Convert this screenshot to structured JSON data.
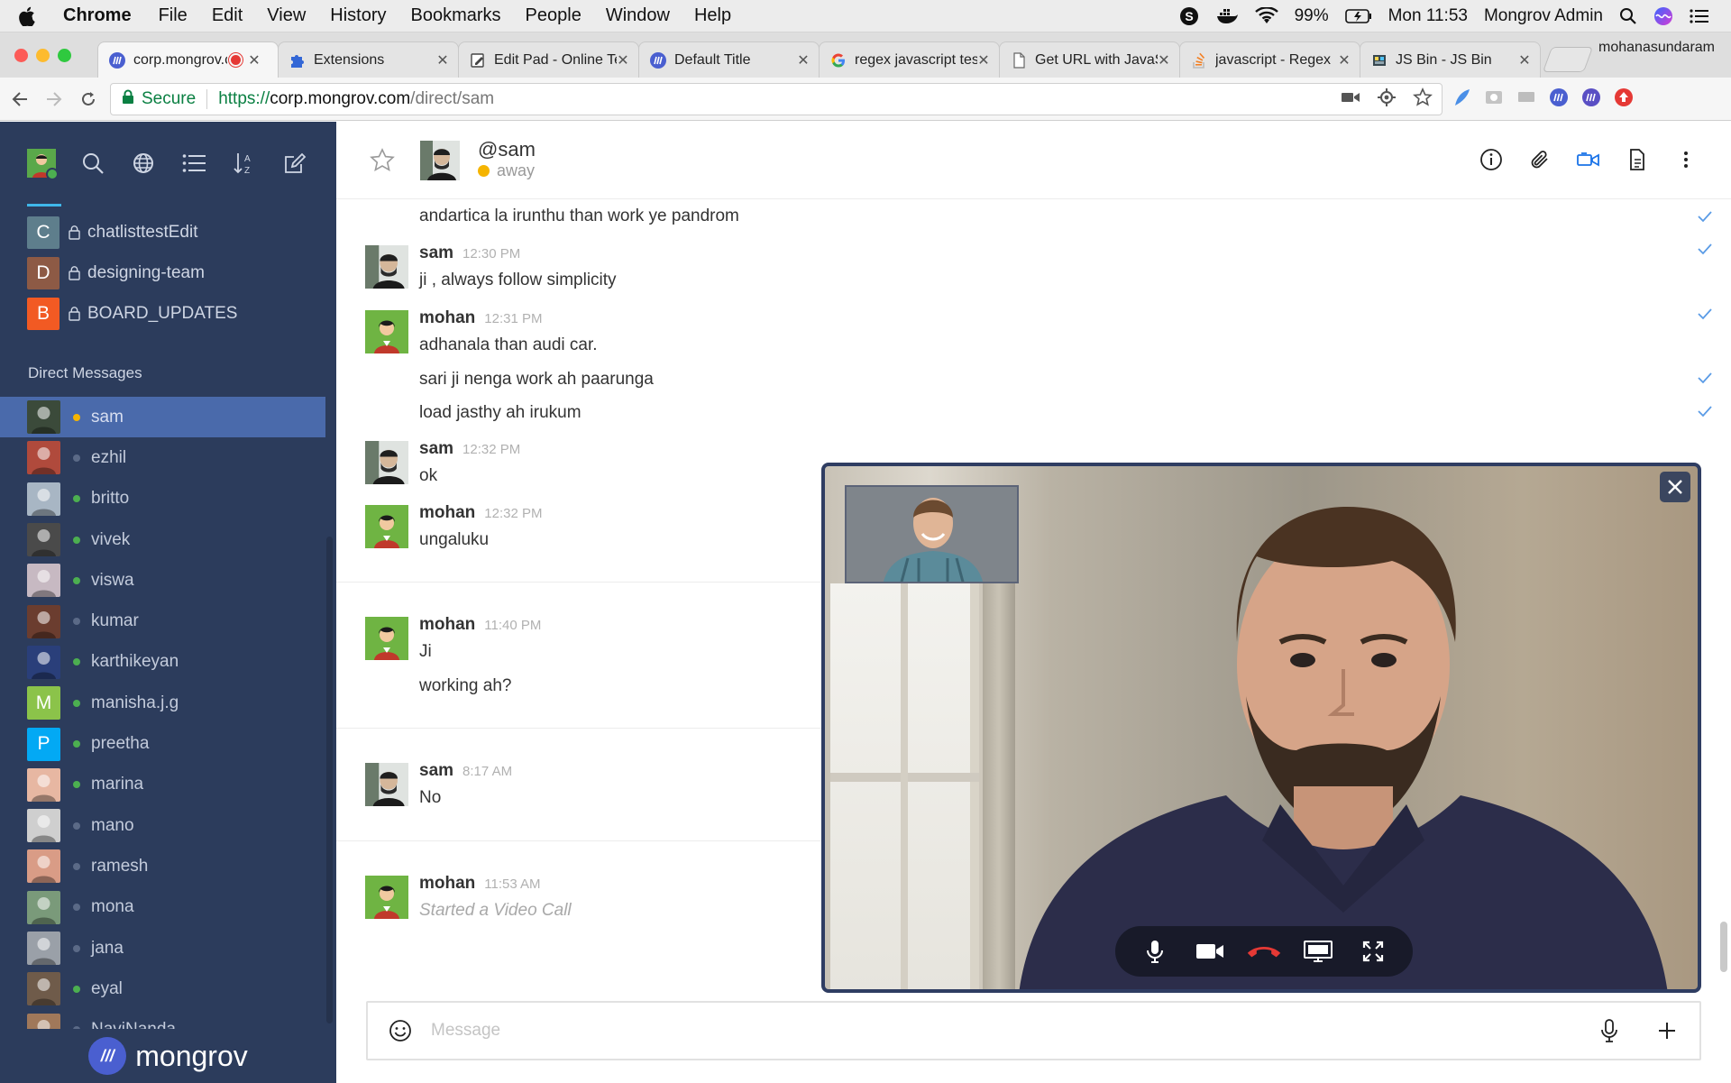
{
  "os_menu": {
    "app_name": "Chrome",
    "items": [
      "File",
      "Edit",
      "View",
      "History",
      "Bookmarks",
      "People",
      "Window",
      "Help"
    ],
    "battery": "99%",
    "clock": "Mon 11:53",
    "user": "Mongrov Admin"
  },
  "browser": {
    "tabs": [
      {
        "title": "corp.mongrov.com",
        "favicon": "mongrov-logo-icon",
        "recording": true,
        "active": true
      },
      {
        "title": "Extensions",
        "favicon": "puzzle-icon"
      },
      {
        "title": "Edit Pad - Online Text Editor",
        "favicon": "editpad-icon"
      },
      {
        "title": "Default Title",
        "favicon": "mongrov-logo-icon"
      },
      {
        "title": "regex javascript tester",
        "favicon": "google-icon"
      },
      {
        "title": "Get URL with JavaScript",
        "favicon": "page-icon"
      },
      {
        "title": "javascript - Regex",
        "favicon": "stackoverflow-icon"
      },
      {
        "title": "JS Bin - JS Bin",
        "favicon": "jsbin-icon"
      }
    ],
    "profile_name": "mohanasundaram",
    "address": {
      "secure_label": "Secure",
      "scheme": "https://",
      "host": "corp.mongrov.com",
      "path": "/direct/sam"
    }
  },
  "sidebar": {
    "channels": [
      {
        "letter": "C",
        "name": "chatlisttestEdit",
        "color": "#5e7e8c"
      },
      {
        "letter": "D",
        "name": "designing-team",
        "color": "#8d5a45"
      },
      {
        "letter": "B",
        "name": "BOARD_UPDATES",
        "color": "#f25a23"
      }
    ],
    "dm_title": "Direct Messages",
    "direct_messages": [
      {
        "name": "sam",
        "status": "away",
        "avatar_color": "#3b4a3a",
        "active": true
      },
      {
        "name": "ezhil",
        "status": "offline",
        "avatar_color": "#b04a3c"
      },
      {
        "name": "britto",
        "status": "online",
        "avatar_color": "#a8b6c4"
      },
      {
        "name": "vivek",
        "status": "online",
        "avatar_color": "#4a4a4a"
      },
      {
        "name": "viswa",
        "status": "online",
        "avatar_color": "#c7b9c2"
      },
      {
        "name": "kumar",
        "status": "offline",
        "avatar_color": "#6b3d2f"
      },
      {
        "name": "karthikeyan",
        "status": "online",
        "avatar_color": "#2a3f7a"
      },
      {
        "name": "manisha.j.g",
        "status": "online",
        "avatar_color": "#8bc34a",
        "letter": "M"
      },
      {
        "name": "preetha",
        "status": "online",
        "avatar_color": "#03a9f4",
        "letter": "P"
      },
      {
        "name": "marina",
        "status": "online",
        "avatar_color": "#e7b7a2"
      },
      {
        "name": "mano",
        "status": "offline",
        "avatar_color": "#cfcfcf"
      },
      {
        "name": "ramesh",
        "status": "offline",
        "avatar_color": "#d99c86"
      },
      {
        "name": "mona",
        "status": "offline",
        "avatar_color": "#7a9a7a"
      },
      {
        "name": "jana",
        "status": "offline",
        "avatar_color": "#9aa0a8"
      },
      {
        "name": "eyal",
        "status": "online",
        "avatar_color": "#6f5b4a"
      },
      {
        "name": "NaviNanda",
        "status": "offline",
        "avatar_color": "#a0785a"
      }
    ],
    "brand": "mongrov",
    "status_colors": {
      "away": "#f5b400",
      "online": "#4caf50",
      "offline": "#5b6a87"
    }
  },
  "chat_header": {
    "name": "@sam",
    "status": "away"
  },
  "messages": [
    {
      "lines": [
        "andartica la irunthu than work ye pandrom"
      ],
      "continuation": true,
      "checks": [
        true
      ]
    },
    {
      "user": "sam",
      "time": "12:30 PM",
      "lines": [
        "ji , always follow simplicity"
      ],
      "checks": [
        true
      ]
    },
    {
      "user": "mohan",
      "time": "12:31 PM",
      "lines": [
        "adhanala than audi car.",
        "sari ji nenga work ah paarunga",
        "load jasthy ah irukum"
      ],
      "checks": [
        true,
        true,
        true
      ]
    },
    {
      "user": "sam",
      "time": "12:32 PM",
      "lines": [
        "ok"
      ]
    },
    {
      "user": "mohan",
      "time": "12:32 PM",
      "lines": [
        "ungaluku"
      ]
    },
    {
      "user": "mohan",
      "time": "11:40 PM",
      "lines": [
        "Ji",
        "working ah?"
      ]
    },
    {
      "user": "sam",
      "time": "8:17 AM",
      "lines": [
        "No"
      ]
    },
    {
      "user": "mohan",
      "time": "11:53 AM",
      "lines": [
        "Started a Video Call"
      ],
      "system": true
    }
  ],
  "composer": {
    "placeholder": "Message"
  }
}
